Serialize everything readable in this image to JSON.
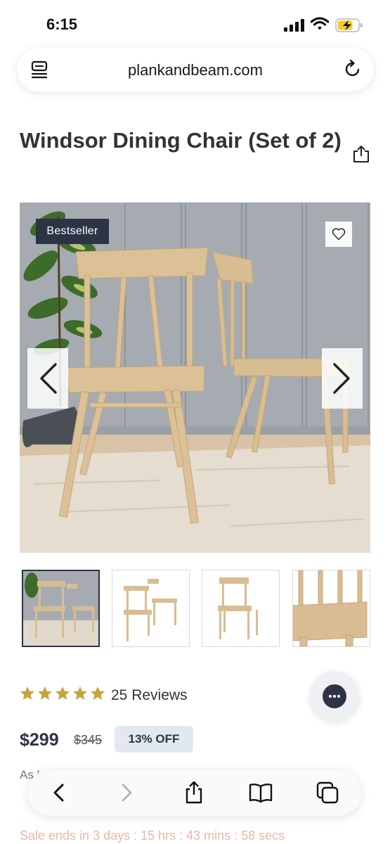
{
  "status_bar": {
    "time": "6:15"
  },
  "browser": {
    "url": "plankandbeam.com"
  },
  "product": {
    "title": "Windsor Dining Chair (Set of 2)",
    "badge": "Bestseller",
    "rating": 5,
    "reviews_label": "25 Reviews",
    "price": "$299",
    "original_price": "$345",
    "discount_label": "13% OFF",
    "partial_text": "As l",
    "sale_countdown": "Sale ends in 3 days : 15 hrs : 43 mins : 58 secs"
  },
  "colors": {
    "brand_navy": "#2c3445",
    "star": "#c9a33c",
    "discount_bg": "#e2e8f0",
    "sale_text": "#e9b7a9"
  },
  "icons": [
    "reader-icon",
    "reload-icon",
    "share-icon",
    "heart-icon",
    "chevron-left-icon",
    "chevron-right-icon",
    "star-icon",
    "chat-icon",
    "back-icon",
    "forward-icon",
    "share-sheet-icon",
    "bookmarks-icon",
    "tabs-icon"
  ]
}
